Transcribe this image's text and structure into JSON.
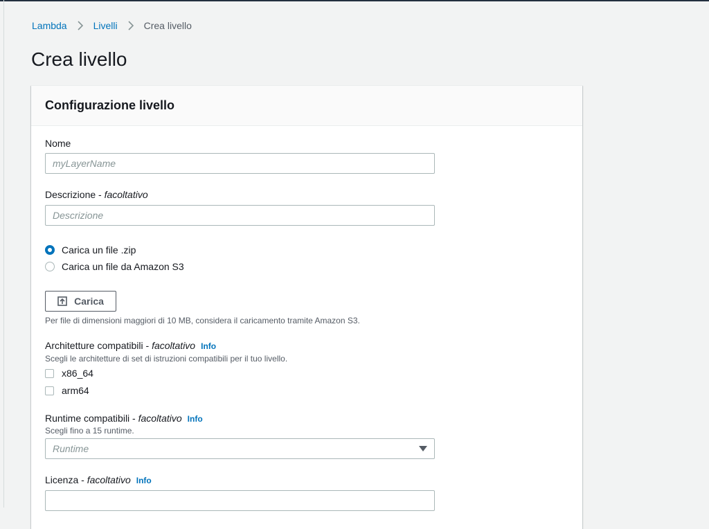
{
  "breadcrumb": {
    "items": [
      "Lambda",
      "Livelli"
    ],
    "current": "Crea livello"
  },
  "page": {
    "title": "Crea livello"
  },
  "panel": {
    "title": "Configurazione livello",
    "name": {
      "label": "Nome",
      "placeholder": "myLayerName",
      "value": ""
    },
    "description": {
      "label": "Descrizione - ",
      "optional": "facoltativo",
      "placeholder": "Descrizione",
      "value": ""
    },
    "source_options": [
      {
        "label": "Carica un file .zip",
        "selected": true
      },
      {
        "label": "Carica un file da Amazon S3",
        "selected": false
      }
    ],
    "upload": {
      "button_label": "Carica",
      "hint": "Per file di dimensioni maggiori di 10 MB, considera il caricamento tramite Amazon S3."
    },
    "architectures": {
      "label": "Architetture compatibili - ",
      "optional": "facoltativo",
      "info": "Info",
      "hint": "Scegli le architetture di set di istruzioni compatibili per il tuo livello.",
      "options": [
        {
          "label": "x86_64",
          "checked": false
        },
        {
          "label": "arm64",
          "checked": false
        }
      ]
    },
    "runtimes": {
      "label": "Runtime compatibili - ",
      "optional": "facoltativo",
      "info": "Info",
      "hint": "Scegli fino a 15 runtime.",
      "placeholder": "Runtime"
    },
    "license": {
      "label": "Licenza - ",
      "optional": "facoltativo",
      "info": "Info",
      "value": ""
    }
  },
  "colors": {
    "link": "#0073bb",
    "text": "#16191f",
    "muted": "#545b64",
    "background": "#f2f3f3"
  },
  "icons": {
    "breadcrumb_separator": "chevron-right-icon",
    "upload": "upload-icon",
    "select_caret": "caret-down-icon"
  }
}
